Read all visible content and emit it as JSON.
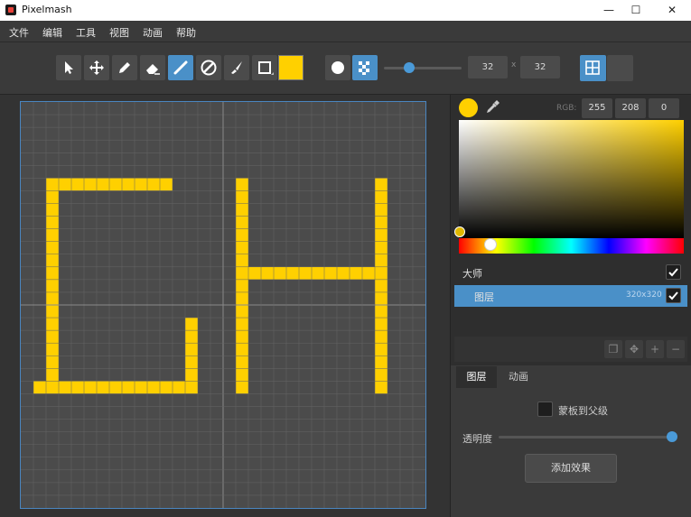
{
  "app": {
    "title": "Pixelmash"
  },
  "window_controls": {
    "minimize": "—",
    "maximize": "☐",
    "close": "✕"
  },
  "menu": [
    "文件",
    "编辑",
    "工具",
    "视图",
    "动画",
    "帮助"
  ],
  "toolbar": {
    "tools": [
      {
        "name": "select-tool",
        "icon": "pointer-icon",
        "active": false
      },
      {
        "name": "move-tool",
        "icon": "move-icon",
        "active": false
      },
      {
        "name": "pencil-tool",
        "icon": "pencil-icon",
        "active": false
      },
      {
        "name": "eraser-tool",
        "icon": "eraser-icon",
        "active": false
      },
      {
        "name": "line-tool",
        "icon": "line-icon",
        "active": true
      },
      {
        "name": "gradient-tool",
        "icon": "gradient-icon",
        "active": false
      },
      {
        "name": "fill-tool",
        "icon": "brush-icon",
        "active": false
      },
      {
        "name": "rect-tool",
        "icon": "rectangle-icon",
        "active": false
      }
    ],
    "current_color": "#ffd000",
    "brush_shapes": [
      {
        "name": "round-brush",
        "icon": "circle-icon",
        "active": false
      },
      {
        "name": "dither-brush",
        "icon": "dither-icon",
        "active": true
      }
    ],
    "brush_size": 32,
    "width_value": "32",
    "height_value": "32",
    "size_separator": "x",
    "grid_toggle_active": true
  },
  "canvas": {
    "grid_cells": 32,
    "pixel_color": "#ffd000",
    "background": "#4b4b4b",
    "grid_line": "#666666",
    "guide_line": "#8a8a8a"
  },
  "color_panel": {
    "current_color": "#ffd000",
    "rgb_label": "RGB:",
    "r": "255",
    "g": "208",
    "b": "0",
    "hue_position": 0.14
  },
  "layers": {
    "master": {
      "label": "大师",
      "checked": true
    },
    "layer": {
      "label": "图层",
      "size": "320x320",
      "checked": true,
      "selected": true
    }
  },
  "tabs": [
    {
      "label": "图层",
      "active": true
    },
    {
      "label": "动画",
      "active": false
    }
  ],
  "properties": {
    "mask_label": "蒙板到父级",
    "opacity_label": "透明度",
    "opacity": 1.0,
    "add_effect": "添加效果"
  },
  "colors": {
    "accent": "#4a90c8",
    "selected_layer": "#4a90c8"
  }
}
